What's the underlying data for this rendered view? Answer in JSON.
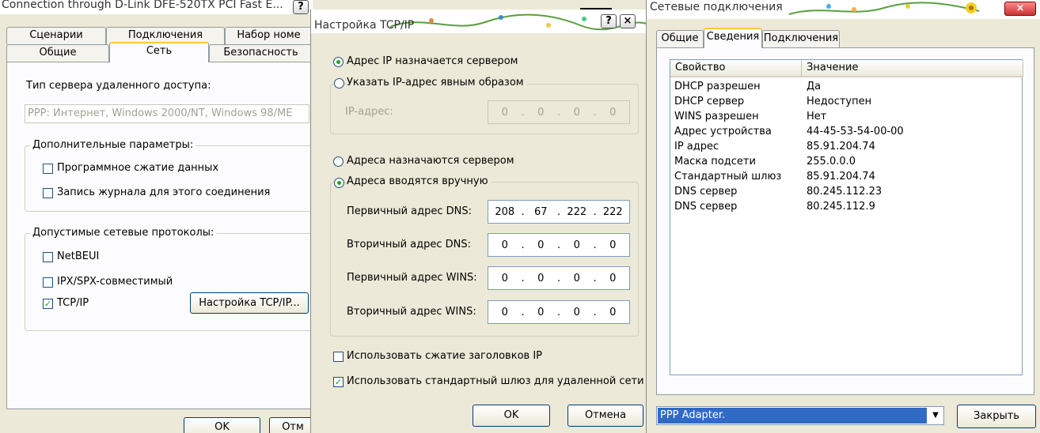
{
  "win1": {
    "title": "Connection through D-Link DFE-520TX PCI Fast E...",
    "tabs_back": [
      "Сценарии",
      "Подключения",
      "Набор номе"
    ],
    "tabs_front": [
      "Общие",
      "Сеть",
      "Безопасность"
    ],
    "server_type_label": "Тип сервера удаленного доступа:",
    "server_type_value": "PPP: Интернет, Windows 2000/NT, Windows 98/ME",
    "advanced_label": "Дополнительные параметры:",
    "software_compression": "Программное сжатие данных",
    "log_connection": "Запись журнала для этого соединения",
    "protocols_label": "Допустимые сетевые протоколы:",
    "netbeui": "NetBEUI",
    "ipx": "IPX/SPX-совместимый",
    "tcpip": "TCP/IP",
    "tcpip_settings": "Настройка TCP/IP...",
    "ok": "OK",
    "cancel": "Отм"
  },
  "win2": {
    "title": "Настройка TCP/IP",
    "help": "?",
    "close": "×",
    "ip_auto": "Адрес IP назначается сервером",
    "ip_manual": "Указать IP-адрес явным образом",
    "ip_label": "IP-адрес:",
    "ip_value": [
      "0",
      "0",
      "0",
      "0"
    ],
    "dns_auto": "Адреса назначаются сервером",
    "dns_manual": "Адреса вводятся вручную",
    "dns1_label": "Первичный адрес DNS:",
    "dns1_value": [
      "208",
      "67",
      "222",
      "222"
    ],
    "dns2_label": "Вторичный адрес DNS:",
    "dns2_value": [
      "0",
      "0",
      "0",
      "0"
    ],
    "wins1_label": "Первичный адрес WINS:",
    "wins1_value": [
      "0",
      "0",
      "0",
      "0"
    ],
    "wins2_label": "Вторичный адрес WINS:",
    "wins2_value": [
      "0",
      "0",
      "0",
      "0"
    ],
    "header_compression": "Использовать сжатие заголовков IP",
    "default_gateway": "Использовать стандартный шлюз для удаленной сети",
    "ok": "OK",
    "cancel": "Отмена"
  },
  "win3": {
    "title": "Сетевые подключения",
    "close": "×",
    "tabs": [
      "Общие",
      "Сведения",
      "Подключения"
    ],
    "col_property": "Свойство",
    "col_value": "Значение",
    "rows": [
      {
        "p": "DHCP разрешен",
        "v": "Да"
      },
      {
        "p": "DHCP сервер",
        "v": "Недоступен"
      },
      {
        "p": "WINS разрешен",
        "v": "Нет"
      },
      {
        "p": "Адрес устройства",
        "v": "44-45-53-54-00-00"
      },
      {
        "p": "IP адрес",
        "v": "85.91.204.74"
      },
      {
        "p": "Маска подсети",
        "v": "255.0.0.0"
      },
      {
        "p": "Стандартный шлюз",
        "v": "85.91.204.74"
      },
      {
        "p": "DNS сервер",
        "v": "80.245.112.23"
      },
      {
        "p": "DNS сервер",
        "v": "80.245.112.9"
      }
    ],
    "adapter": "PPP Adapter.",
    "close_button": "Закрыть"
  },
  "colors": {
    "selection": "#316ac5",
    "checkmark": "#21a121",
    "tab_highlight": "#ffc83c"
  }
}
